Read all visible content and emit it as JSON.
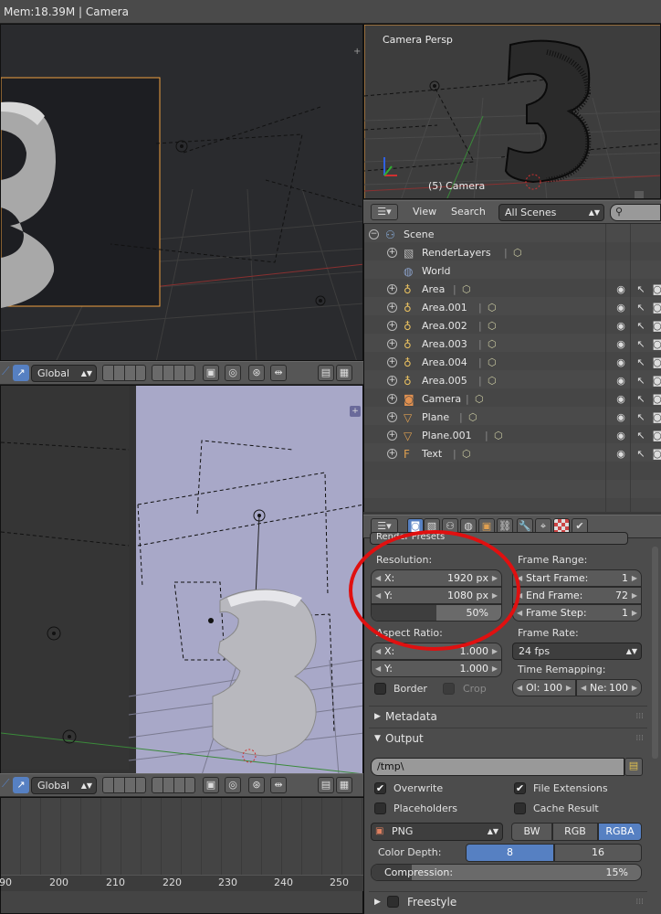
{
  "app": {
    "title_bar": "Mem:18.39M | Camera"
  },
  "left_top_view": {
    "orientation": "Global"
  },
  "left_bottom_view": {
    "orientation": "Global"
  },
  "timeline": {
    "ticks": [
      "90",
      "200",
      "210",
      "220",
      "230",
      "240",
      "250"
    ]
  },
  "camera_view": {
    "label": "Camera Persp",
    "object_label": "(5) Camera"
  },
  "outliner": {
    "menu_view": "View",
    "menu_search": "Search",
    "scene_filter": "All Scenes",
    "items": [
      {
        "label": "Scene",
        "depth": 0
      },
      {
        "label": "RenderLayers",
        "depth": 1
      },
      {
        "label": "World",
        "depth": 1
      },
      {
        "label": "Area",
        "depth": 1
      },
      {
        "label": "Area.001",
        "depth": 1
      },
      {
        "label": "Area.002",
        "depth": 1
      },
      {
        "label": "Area.003",
        "depth": 1
      },
      {
        "label": "Area.004",
        "depth": 1
      },
      {
        "label": "Area.005",
        "depth": 1
      },
      {
        "label": "Camera",
        "depth": 1
      },
      {
        "label": "Plane",
        "depth": 1
      },
      {
        "label": "Plane.001",
        "depth": 1
      },
      {
        "label": "Text",
        "depth": 1
      }
    ]
  },
  "properties": {
    "presets_label": "Render Presets",
    "resolution_label": "Resolution:",
    "res_x_label": "X:",
    "res_x": "1920 px",
    "res_y_label": "Y:",
    "res_y": "1080 px",
    "res_pct": "50%",
    "res_pct_value": 0.5,
    "aspect_label": "Aspect Ratio:",
    "aspect_x_label": "X:",
    "aspect_x": "1.000",
    "aspect_y_label": "Y:",
    "aspect_y": "1.000",
    "border_label": "Border",
    "crop_label": "Crop",
    "frame_range_label": "Frame Range:",
    "start_label": "Start Frame:",
    "start": "1",
    "end_label": "End Frame:",
    "end": "72",
    "step_label": "Frame Step:",
    "step": "1",
    "frame_rate_label": "Frame Rate:",
    "fps": "24 fps",
    "time_remap_label": "Time Remapping:",
    "old_label": "Ol:",
    "old": "100",
    "new_label": "Ne:",
    "new": "100",
    "metadata_label": "Metadata",
    "output_label": "Output",
    "output_path": "/tmp\\",
    "overwrite_label": "Overwrite",
    "file_ext_label": "File Extensions",
    "placeholders_label": "Placeholders",
    "cache_label": "Cache Result",
    "format": "PNG",
    "bw_label": "BW",
    "rgb_label": "RGB",
    "rgba_label": "RGBA",
    "color_depth_label": "Color Depth:",
    "depth_8": "8",
    "depth_16": "16",
    "compression_label": "Compression:",
    "compression": "15%",
    "compression_value": 0.15,
    "freestyle_label": "Freestyle"
  },
  "colors": {
    "accent_blue": "#5680c2",
    "select_orange": "#f0a040",
    "annotation_red": "#e01010"
  }
}
